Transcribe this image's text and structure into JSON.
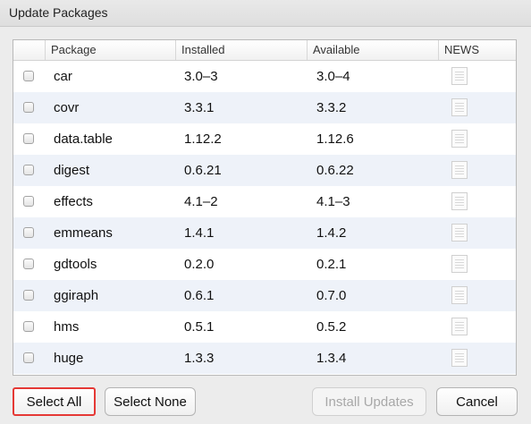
{
  "window": {
    "title": "Update Packages"
  },
  "table": {
    "headers": [
      "",
      "Package",
      "Installed",
      "Available",
      "NEWS"
    ],
    "rows": [
      {
        "package": "car",
        "installed": "3.0–3",
        "available": "3.0–4"
      },
      {
        "package": "covr",
        "installed": "3.3.1",
        "available": "3.3.2"
      },
      {
        "package": "data.table",
        "installed": "1.12.2",
        "available": "1.12.6"
      },
      {
        "package": "digest",
        "installed": "0.6.21",
        "available": "0.6.22"
      },
      {
        "package": "effects",
        "installed": "4.1–2",
        "available": "4.1–3"
      },
      {
        "package": "emmeans",
        "installed": "1.4.1",
        "available": "1.4.2"
      },
      {
        "package": "gdtools",
        "installed": "0.2.0",
        "available": "0.2.1"
      },
      {
        "package": "ggiraph",
        "installed": "0.6.1",
        "available": "0.7.0"
      },
      {
        "package": "hms",
        "installed": "0.5.1",
        "available": "0.5.2"
      },
      {
        "package": "huge",
        "installed": "1.3.3",
        "available": "1.3.4"
      }
    ]
  },
  "buttons": {
    "select_all": "Select All",
    "select_none": "Select None",
    "install_updates": "Install Updates",
    "cancel": "Cancel"
  },
  "colors": {
    "row_alt": "#eef2f9",
    "highlight_border": "#e53935",
    "disabled_text": "#a8a8a8"
  },
  "icons": {
    "news": "news-document-icon"
  }
}
